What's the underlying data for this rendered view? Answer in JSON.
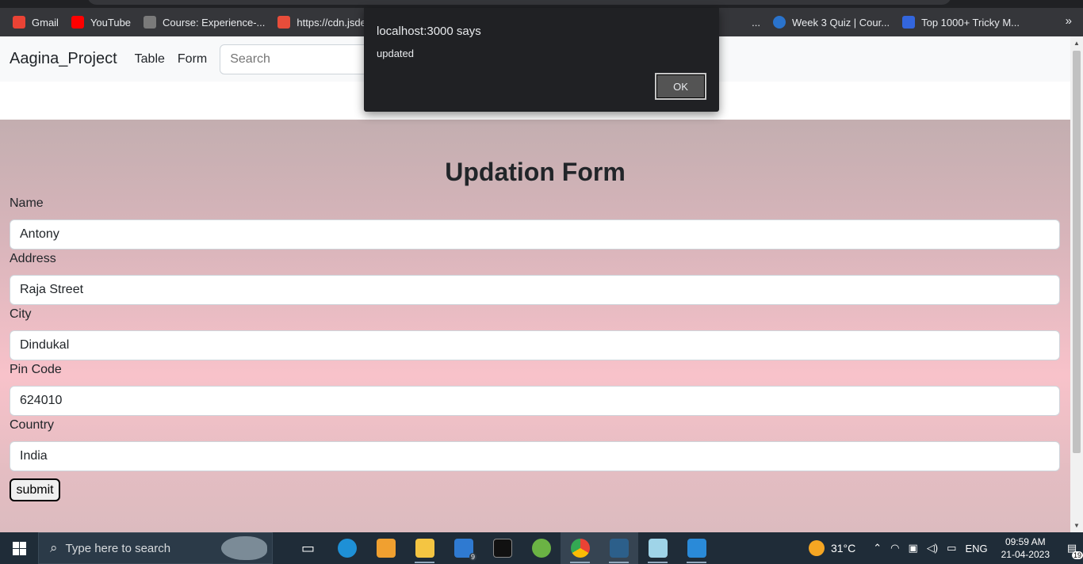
{
  "bookmarks": [
    {
      "label": "Gmail",
      "icon": "gmail-icon",
      "color": "#ea4335"
    },
    {
      "label": "YouTube",
      "icon": "youtube-icon",
      "color": "#ff0000"
    },
    {
      "label": "Course: Experience-...",
      "icon": "course-icon",
      "color": "#7a7a7a"
    },
    {
      "label": "https://cdn.jsdelivr....",
      "icon": "jsdelivr-icon",
      "color": "#e84d3a"
    },
    {
      "label": "...",
      "icon": "",
      "color": "#35363a"
    },
    {
      "label": "Week 3 Quiz | Cour...",
      "icon": "coursera-icon",
      "color": "#2a73cc"
    },
    {
      "label": "Top 1000+ Tricky M...",
      "icon": "bookmark-site-icon",
      "color": "#3366dd"
    }
  ],
  "bookmarks_more": "»",
  "navbar": {
    "brand": "Aagina_Project",
    "links": [
      "Table",
      "Form"
    ],
    "search_placeholder": "Search"
  },
  "form": {
    "title": "Updation Form",
    "fields": [
      {
        "label": "Name",
        "value": "Antony"
      },
      {
        "label": "Address",
        "value": "Raja Street"
      },
      {
        "label": "City",
        "value": "Dindukal"
      },
      {
        "label": "Pin Code",
        "value": "624010"
      },
      {
        "label": "Country",
        "value": "India"
      }
    ],
    "submit_label": "submit"
  },
  "alert": {
    "title": "localhost:3000 says",
    "message": "updated",
    "ok_label": "OK"
  },
  "taskbar": {
    "search_placeholder": "Type here to search",
    "mail_badge": "9",
    "weather": "31°C",
    "language": "ENG",
    "time": "09:59 AM",
    "date": "21-04-2023",
    "notification_count": "19"
  },
  "colors": {
    "form_gradient_top": "#c3aeb0",
    "form_gradient_mid": "#f8c2ca",
    "alert_bg": "#202124"
  }
}
